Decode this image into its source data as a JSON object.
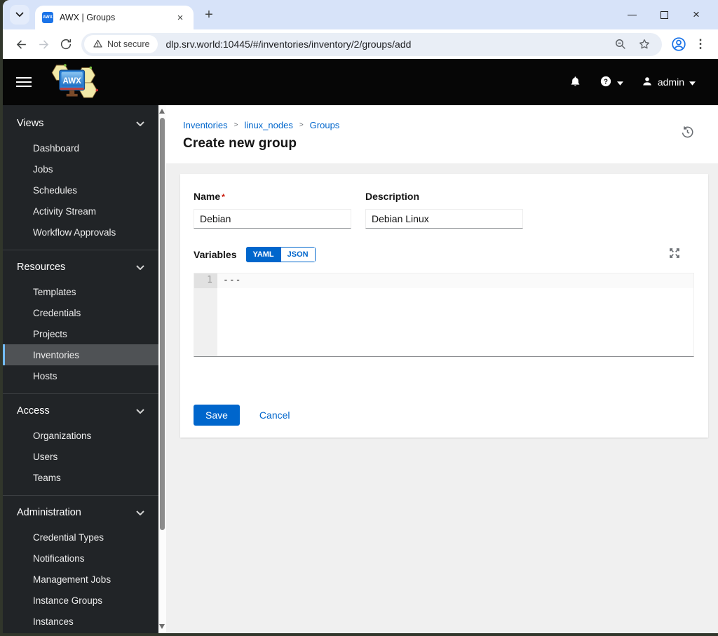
{
  "browser": {
    "tab_title": "AWX | Groups",
    "favicon_label": "AWX",
    "security_chip": "Not secure",
    "url": "dlp.srv.world:10445/#/inventories/inventory/2/groups/add",
    "glyphs": {
      "tab_close": "×",
      "new_tab": "+",
      "win_close": "×",
      "kebab": "⋮"
    }
  },
  "appbar": {
    "logo_label": "AWX",
    "user_name": "admin"
  },
  "sidebar": {
    "active_item": "Inventories",
    "sections": [
      {
        "label": "Views",
        "items": [
          "Dashboard",
          "Jobs",
          "Schedules",
          "Activity Stream",
          "Workflow Approvals"
        ]
      },
      {
        "label": "Resources",
        "items": [
          "Templates",
          "Credentials",
          "Projects",
          "Inventories",
          "Hosts"
        ]
      },
      {
        "label": "Access",
        "items": [
          "Organizations",
          "Users",
          "Teams"
        ]
      },
      {
        "label": "Administration",
        "items": [
          "Credential Types",
          "Notifications",
          "Management Jobs",
          "Instance Groups",
          "Instances"
        ]
      }
    ]
  },
  "main": {
    "breadcrumb": {
      "items": [
        "Inventories",
        "linux_nodes",
        "Groups"
      ],
      "sep": ">"
    },
    "title": "Create new group",
    "form": {
      "name_label": "Name",
      "required_marker": "*",
      "name_value": "Debian",
      "description_label": "Description",
      "description_value": "Debian Linux",
      "variables_label": "Variables",
      "toggle_yaml": "YAML",
      "toggle_json": "JSON",
      "editor": {
        "line_number": "1",
        "line1": "---"
      },
      "save_label": "Save",
      "cancel_label": "Cancel"
    }
  },
  "colors": {
    "primary": "#0066cc",
    "header_bg": "#060606",
    "sidebar_bg": "#212427",
    "sidebar_active_bg": "#4f5255",
    "sidebar_active_indicator": "#73bcf7",
    "content_bg": "#f0f0f0",
    "required_red": "#c9190b",
    "chrome_tabstrip": "#d7e3f9"
  }
}
